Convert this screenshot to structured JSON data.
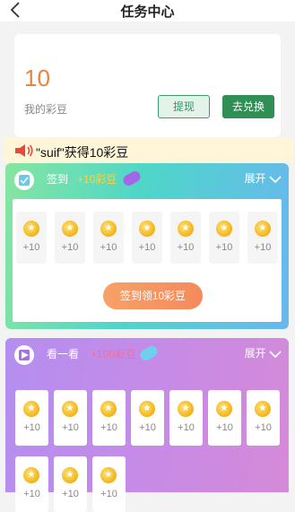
{
  "header": {
    "title": "任务中心",
    "back_icon": "chevron-left-icon"
  },
  "beans": {
    "value": "10",
    "label": "我的彩豆",
    "withdraw_label": "提现",
    "exchange_label": "去兑换"
  },
  "notice": {
    "icon": "speaker-icon",
    "text": "\"suif\"获得10彩豆"
  },
  "signin": {
    "icon": "checkbox-icon",
    "name": "签到",
    "reward": "+10彩豆",
    "expand_label": "展开",
    "days": [
      "+10",
      "+10",
      "+10",
      "+10",
      "+10",
      "+10",
      "+10"
    ],
    "button_label": "签到领10彩豆",
    "colors": {
      "reward": "#f8d443",
      "button": "#f58a5b"
    }
  },
  "watch": {
    "icon": "video-icon",
    "name": "看一看",
    "reward": "+100彩豆",
    "expand_label": "展开",
    "items": [
      "+10",
      "+10",
      "+10",
      "+10",
      "+10",
      "+10",
      "+10",
      "+10",
      "+10",
      "+10"
    ],
    "colors": {
      "reward": "#f16ea0"
    }
  }
}
